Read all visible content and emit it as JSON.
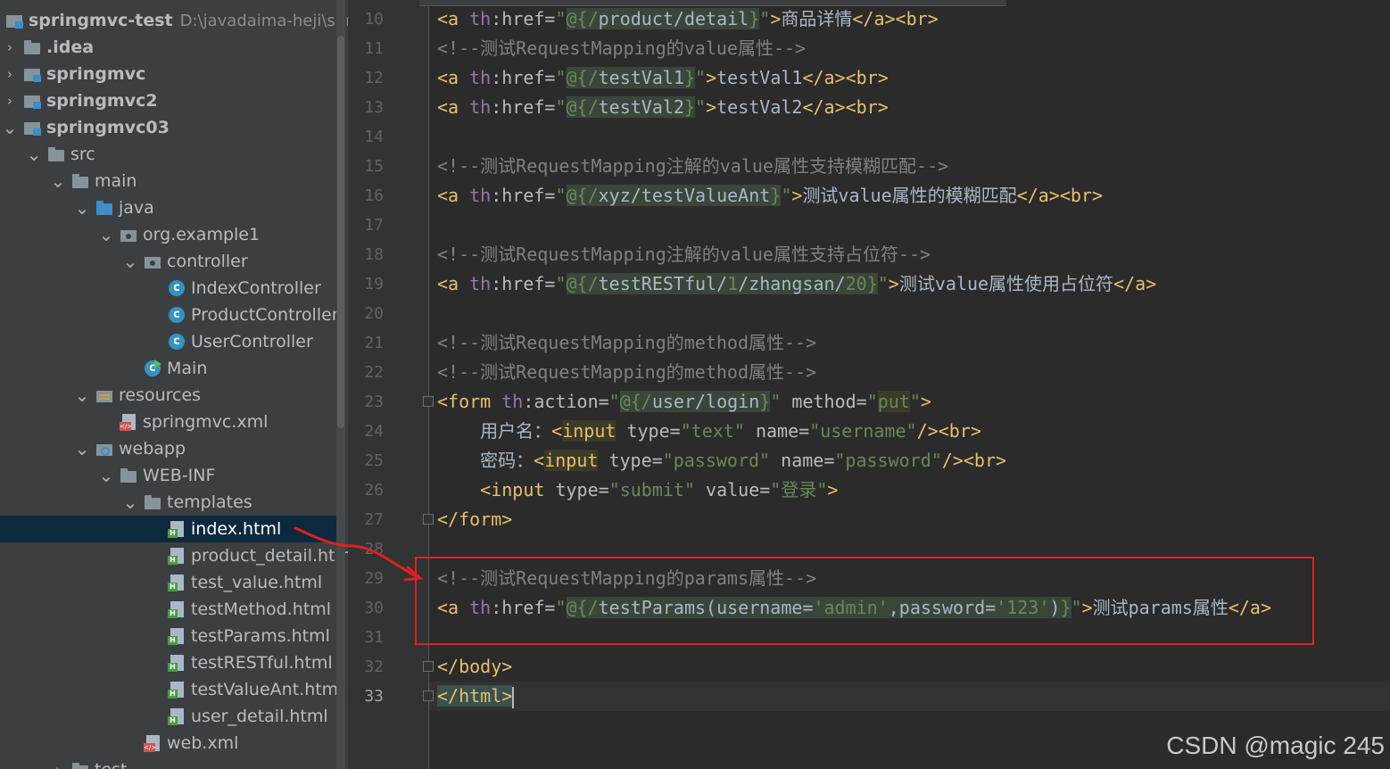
{
  "project": {
    "root_name": "springmvc-test",
    "root_path": "D:\\javadaima-heji\\spring",
    "items": [
      {
        "label": ".idea",
        "icon": "folder-icon",
        "expanded": false
      },
      {
        "label": "springmvc",
        "icon": "module-icon",
        "expanded": false
      },
      {
        "label": "springmvc2",
        "icon": "module-icon",
        "expanded": false
      },
      {
        "label": "springmvc03",
        "icon": "module-icon",
        "expanded": true
      },
      {
        "label": "src",
        "icon": "folder-icon",
        "expanded": true
      },
      {
        "label": "main",
        "icon": "folder-icon",
        "expanded": true
      },
      {
        "label": "java",
        "icon": "source-folder-icon",
        "expanded": true
      },
      {
        "label": "org.example1",
        "icon": "package-icon",
        "expanded": true
      },
      {
        "label": "controller",
        "icon": "package-icon",
        "expanded": true
      },
      {
        "label": "IndexController",
        "icon": "class-icon"
      },
      {
        "label": "ProductController",
        "icon": "class-icon"
      },
      {
        "label": "UserController",
        "icon": "class-icon"
      },
      {
        "label": "Main",
        "icon": "main-class-icon"
      },
      {
        "label": "resources",
        "icon": "resources-folder-icon",
        "expanded": true
      },
      {
        "label": "springmvc.xml",
        "icon": "xml-file-icon"
      },
      {
        "label": "webapp",
        "icon": "web-folder-icon",
        "expanded": true
      },
      {
        "label": "WEB-INF",
        "icon": "folder-icon",
        "expanded": true
      },
      {
        "label": "templates",
        "icon": "folder-icon",
        "expanded": true
      },
      {
        "label": "index.html",
        "icon": "html-file-icon",
        "selected": true
      },
      {
        "label": "product_detail.html",
        "icon": "html-file-icon"
      },
      {
        "label": "test_value.html",
        "icon": "html-file-icon"
      },
      {
        "label": "testMethod.html",
        "icon": "html-file-icon"
      },
      {
        "label": "testParams.html",
        "icon": "html-file-icon"
      },
      {
        "label": "testRESTful.html",
        "icon": "html-file-icon"
      },
      {
        "label": "testValueAnt.html",
        "icon": "html-file-icon"
      },
      {
        "label": "user_detail.html",
        "icon": "html-file-icon"
      },
      {
        "label": "web.xml",
        "icon": "xml-file-icon"
      },
      {
        "label": "test",
        "icon": "folder-icon",
        "expanded": false
      }
    ]
  },
  "editor": {
    "line_numbers": [
      "10",
      "11",
      "12",
      "13",
      "14",
      "15",
      "16",
      "17",
      "18",
      "19",
      "20",
      "21",
      "22",
      "23",
      "24",
      "25",
      "26",
      "27",
      "28",
      "29",
      "30",
      "31",
      "32",
      "33"
    ],
    "current_line": "33",
    "lines": [
      {
        "text": "<a th:href=\"@{/product/detail}\">商品详情</a><br>"
      },
      {
        "text": "<!--测试RequestMapping的value属性-->"
      },
      {
        "text": "<a th:href=\"@{/testVal1}\">testVal1</a><br>"
      },
      {
        "text": "<a th:href=\"@{/testVal2}\">testVal2</a><br>"
      },
      {
        "text": ""
      },
      {
        "text": "<!--测试RequestMapping注解的value属性支持模糊匹配-->"
      },
      {
        "text": "<a th:href=\"@{/xyz/testValueAnt}\">测试value属性的模糊匹配</a><br>"
      },
      {
        "text": ""
      },
      {
        "text": "<!--测试RequestMapping注解的value属性支持占位符-->"
      },
      {
        "text": "<a th:href=\"@{/testRESTful/1/zhangsan/20}\">测试value属性使用占位符</a>"
      },
      {
        "text": ""
      },
      {
        "text": "<!--测试RequestMapping的method属性-->"
      },
      {
        "text": "<!--测试RequestMapping的method属性-->"
      },
      {
        "text": "<form th:action=\"@{/user/login}\" method=\"put\">"
      },
      {
        "text": "    用户名：<input type=\"text\" name=\"username\"/><br>"
      },
      {
        "text": "    密码：<input type=\"password\" name=\"password\"/><br>"
      },
      {
        "text": "    <input type=\"submit\" value=\"登录\">"
      },
      {
        "text": "</form>"
      },
      {
        "text": ""
      },
      {
        "text": "<!--测试RequestMapping的params属性-->"
      },
      {
        "text": "<a th:href=\"@{/testParams(username='admin',password='123')}\">测试params属性</a>"
      },
      {
        "text": ""
      },
      {
        "text": "</body>"
      },
      {
        "text": "</html>"
      }
    ]
  },
  "annotation": {
    "color": "#e02020"
  },
  "watermark": "CSDN @magic 245"
}
